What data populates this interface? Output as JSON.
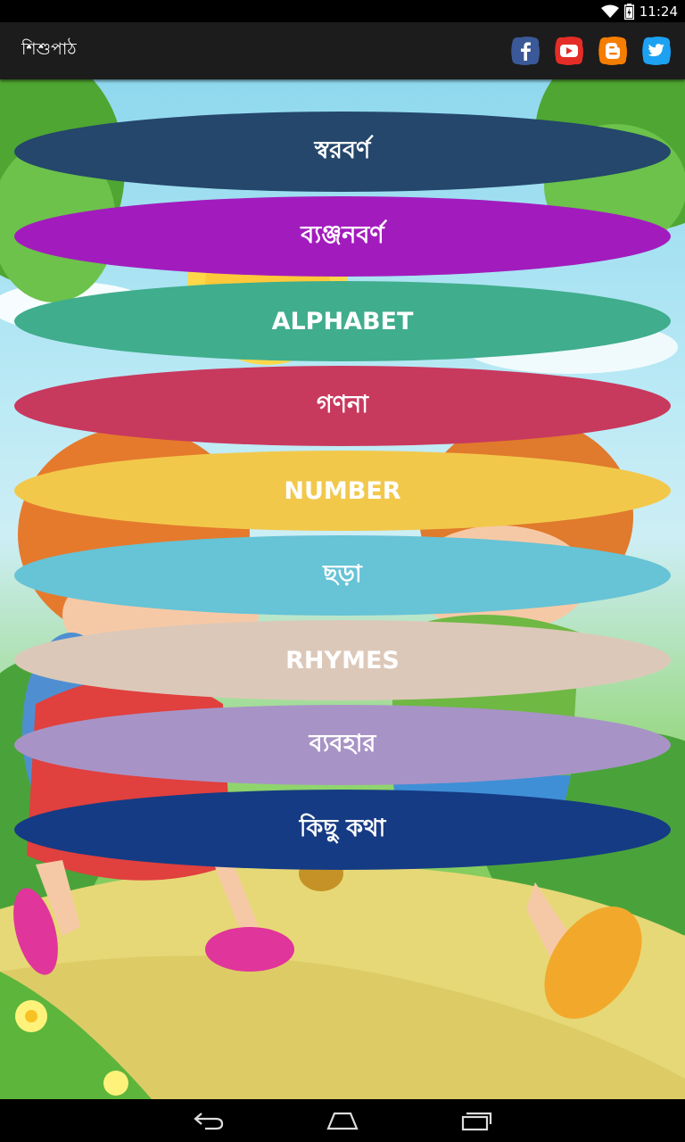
{
  "status_bar": {
    "time": "11:24",
    "icons": [
      "wifi-icon",
      "battery-icon"
    ]
  },
  "app_bar": {
    "title": "শিশুপাঠ",
    "social": [
      {
        "name": "facebook-icon",
        "color": "#3b5998"
      },
      {
        "name": "youtube-icon",
        "color": "#e52d27"
      },
      {
        "name": "blogger-icon",
        "color": "#f57d00"
      },
      {
        "name": "twitter-icon",
        "color": "#1da1f2"
      }
    ]
  },
  "menu": {
    "items": [
      {
        "key": "sorborno",
        "label": "স্বরবর্ণ",
        "color": "#24476b"
      },
      {
        "key": "byanjonborno",
        "label": "ব্যঞ্জনবর্ণ",
        "color": "#a21cbd"
      },
      {
        "key": "alphabet",
        "label": "ALPHABET",
        "color": "#40ad8d"
      },
      {
        "key": "gonona",
        "label": "গণনা",
        "color": "#c8395e"
      },
      {
        "key": "number",
        "label": "NUMBER",
        "color": "#f2c84b"
      },
      {
        "key": "chhora",
        "label": "ছড়া",
        "color": "#67c3d6"
      },
      {
        "key": "rhymes",
        "label": "RHYMES",
        "color": "#dcc8b9"
      },
      {
        "key": "byabohar",
        "label": "ব্যবহার",
        "color": "#a893c6"
      },
      {
        "key": "kichhu_kotha",
        "label": "কিছু কথা",
        "color": "#153b84"
      }
    ]
  },
  "nav_bar": {
    "buttons": [
      "back-icon",
      "home-icon",
      "recents-icon"
    ]
  }
}
